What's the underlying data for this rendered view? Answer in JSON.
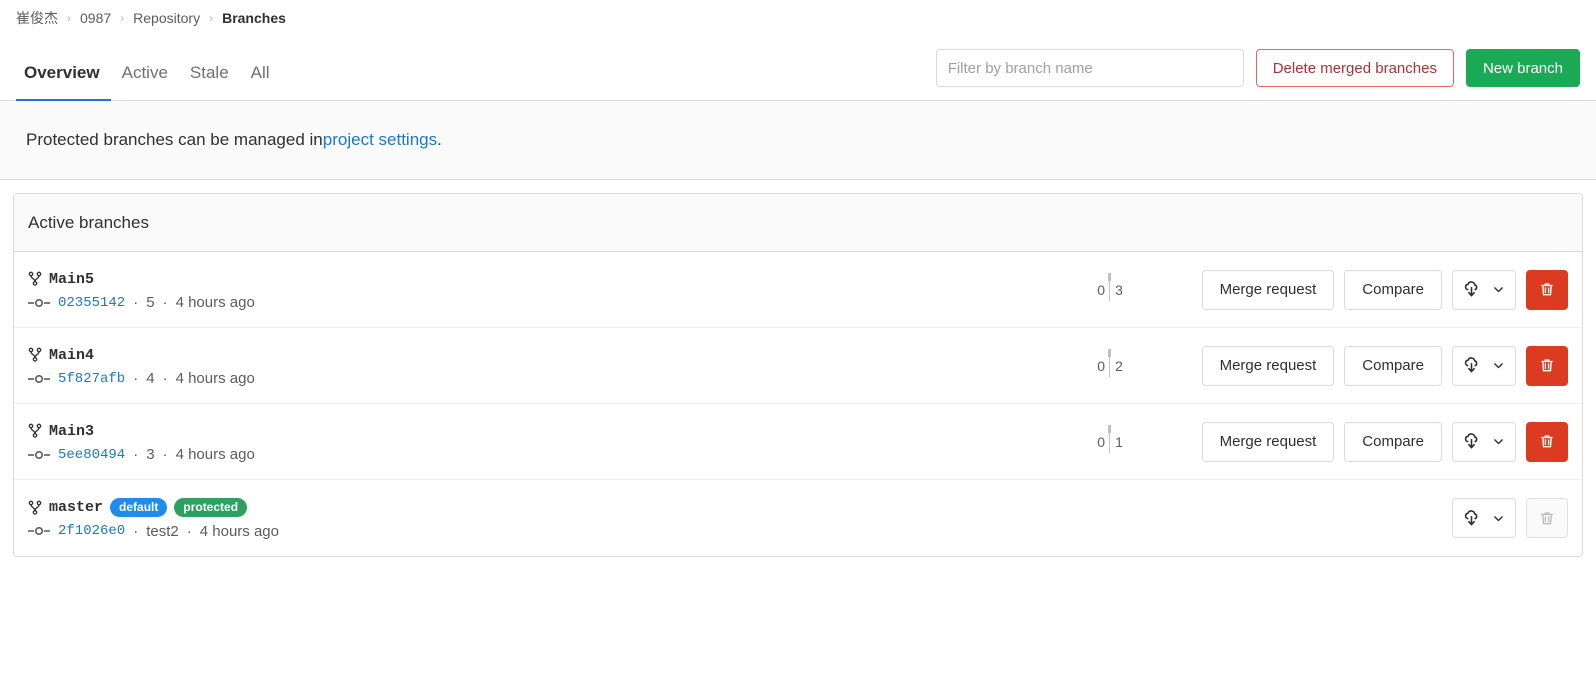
{
  "breadcrumb": {
    "items": [
      {
        "label": "崔俊杰",
        "current": false
      },
      {
        "label": "0987",
        "current": false
      },
      {
        "label": "Repository",
        "current": false
      },
      {
        "label": "Branches",
        "current": true
      }
    ],
    "separator": "›"
  },
  "tabs": [
    {
      "label": "Overview",
      "active": true
    },
    {
      "label": "Active",
      "active": false
    },
    {
      "label": "Stale",
      "active": false
    },
    {
      "label": "All",
      "active": false
    }
  ],
  "toolbar": {
    "filter_placeholder": "Filter by branch name",
    "filter_value": "",
    "delete_merged_label": "Delete merged branches",
    "new_branch_label": "New branch"
  },
  "notice": {
    "text_before": "Protected branches can be managed in ",
    "link_label": "project settings",
    "text_after": "."
  },
  "card": {
    "header": "Active branches"
  },
  "branch_row_labels": {
    "merge_request": "Merge request",
    "compare": "Compare",
    "separator": "·"
  },
  "colors": {
    "accent_blue": "#1f75cb",
    "success_green": "#1aaa55",
    "danger_red": "#db3b21",
    "badge_default": "#1f8ceb",
    "badge_protected": "#2da160"
  },
  "branches": [
    {
      "name": "Main5",
      "badges": [],
      "sha": "02355142",
      "commit_title": "5",
      "time": "4 hours ago",
      "behind": "0",
      "ahead": "3",
      "show_merge_request": true,
      "show_compare": true,
      "delete_enabled": true
    },
    {
      "name": "Main4",
      "badges": [],
      "sha": "5f827afb",
      "commit_title": "4",
      "time": "4 hours ago",
      "behind": "0",
      "ahead": "2",
      "show_merge_request": true,
      "show_compare": true,
      "delete_enabled": true
    },
    {
      "name": "Main3",
      "badges": [],
      "sha": "5ee80494",
      "commit_title": "3",
      "time": "4 hours ago",
      "behind": "0",
      "ahead": "1",
      "show_merge_request": true,
      "show_compare": true,
      "delete_enabled": true
    },
    {
      "name": "master",
      "badges": [
        {
          "label": "default",
          "kind": "default"
        },
        {
          "label": "protected",
          "kind": "protected"
        }
      ],
      "sha": "2f1026e0",
      "commit_title": "test2",
      "time": "4 hours ago",
      "behind": "",
      "ahead": "",
      "show_merge_request": false,
      "show_compare": false,
      "delete_enabled": false
    }
  ]
}
